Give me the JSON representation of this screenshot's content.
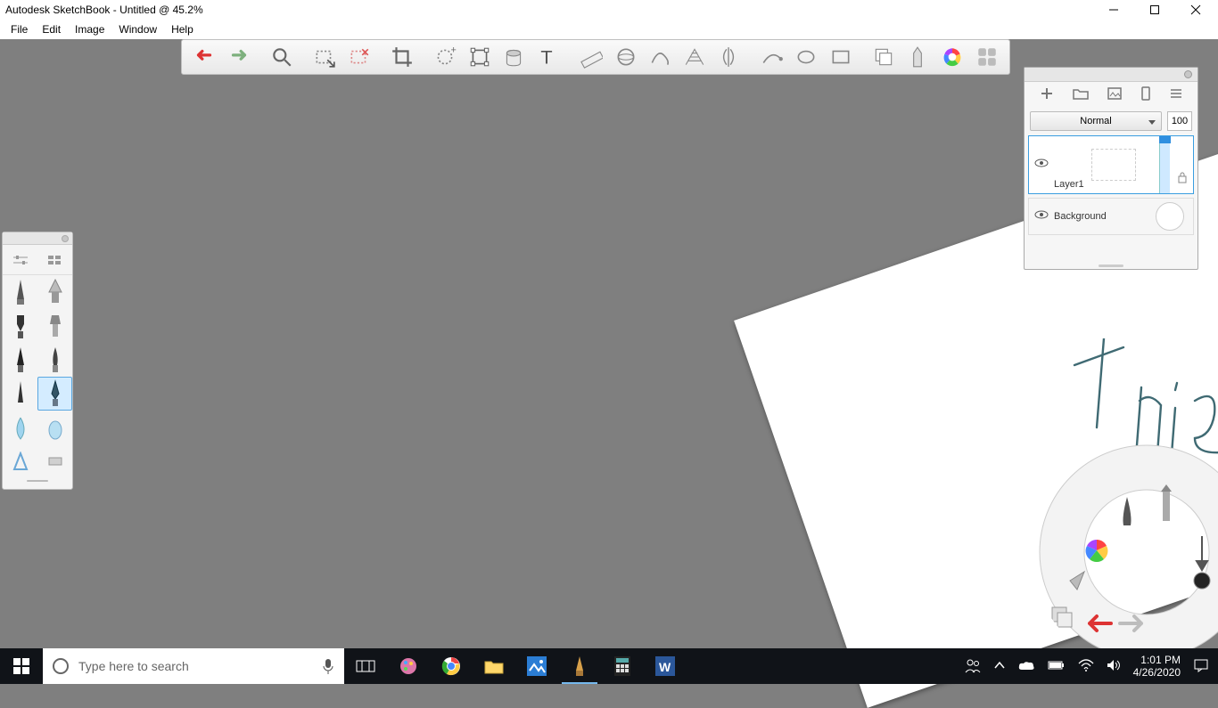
{
  "window": {
    "title": "Autodesk SketchBook - Untitled @ 45.2%"
  },
  "menu": {
    "file": "File",
    "edit": "Edit",
    "image": "Image",
    "window": "Window",
    "help": "Help"
  },
  "layers": {
    "blend_mode": "Normal",
    "opacity": "100",
    "layer1_name": "Layer1",
    "background_name": "Background"
  },
  "taskbar": {
    "search_placeholder": "Type here to search",
    "time": "1:01 PM",
    "date": "4/26/2020"
  }
}
